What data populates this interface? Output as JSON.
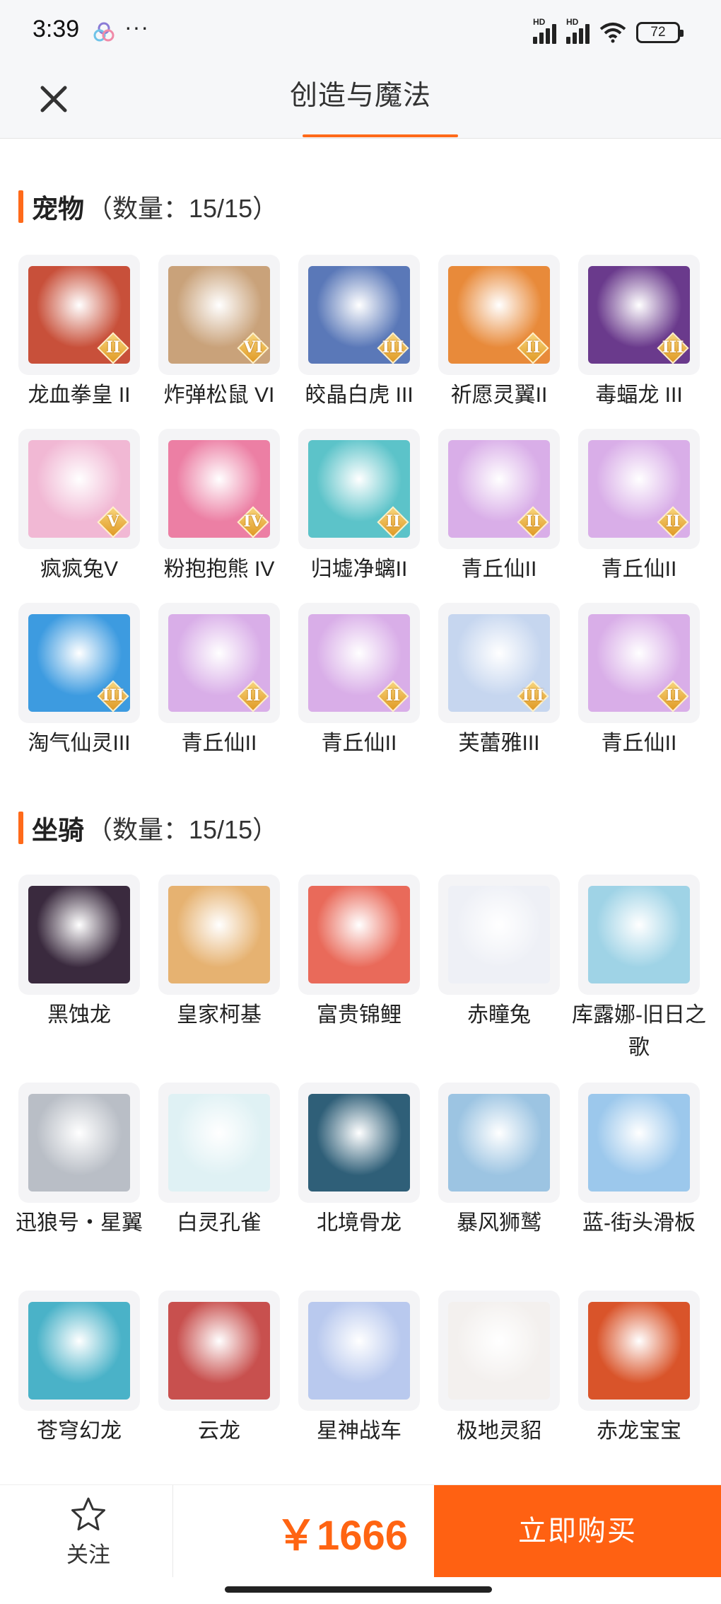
{
  "status_bar": {
    "time": "3:39",
    "more": "···",
    "battery": "72",
    "signal_label": "HD"
  },
  "header": {
    "title": "创造与魔法"
  },
  "pets": {
    "name": "宠物",
    "count": "（数量：15/15）",
    "items": [
      {
        "label": "龙血拳皇 II",
        "badge": "II",
        "icon": "red-dragon-fighter",
        "color": "#c8503a"
      },
      {
        "label": "炸弹松鼠 VI",
        "badge": "VI",
        "icon": "bomb-squirrel",
        "color": "#c9a27a"
      },
      {
        "label": "皎晶白虎 III",
        "badge": "III",
        "icon": "crystal-white-tiger",
        "color": "#5a78b8"
      },
      {
        "label": "祈愿灵翼II",
        "badge": "II",
        "icon": "wish-spirit-wing",
        "color": "#e88a3a"
      },
      {
        "label": "毒蝠龙 III",
        "badge": "III",
        "icon": "poison-bat-dragon",
        "color": "#6a3a8c"
      },
      {
        "label": "疯疯兔V",
        "badge": "V",
        "icon": "crazy-rabbit",
        "color": "#f1b8d4"
      },
      {
        "label": "粉抱抱熊 IV",
        "badge": "IV",
        "icon": "pink-hug-bear",
        "color": "#ec7fa4"
      },
      {
        "label": "归墟净螭II",
        "badge": "II",
        "icon": "sea-chi-dragon",
        "color": "#5cc3c9"
      },
      {
        "label": "青丘仙II",
        "badge": "II",
        "icon": "qingqiu-fairy",
        "color": "#d9aee8"
      },
      {
        "label": "青丘仙II",
        "badge": "II",
        "icon": "qingqiu-fairy",
        "color": "#d9aee8"
      },
      {
        "label": "淘气仙灵III",
        "badge": "III",
        "icon": "naughty-spirit",
        "color": "#3d9be0"
      },
      {
        "label": "青丘仙II",
        "badge": "II",
        "icon": "qingqiu-fairy",
        "color": "#d9aee8"
      },
      {
        "label": "青丘仙II",
        "badge": "II",
        "icon": "qingqiu-fairy",
        "color": "#d9aee8"
      },
      {
        "label": "芙蕾雅III",
        "badge": "III",
        "icon": "freya",
        "color": "#c6d6ef"
      },
      {
        "label": "青丘仙II",
        "badge": "II",
        "icon": "qingqiu-fairy",
        "color": "#d9aee8"
      }
    ]
  },
  "mounts": {
    "name": "坐骑",
    "count": "（数量：15/15）",
    "items": [
      {
        "label": "黑蚀龙",
        "icon": "black-eclipse-dragon",
        "color": "#3a2a3e"
      },
      {
        "label": "皇家柯基",
        "icon": "royal-corgi",
        "color": "#e6b271"
      },
      {
        "label": "富贵锦鲤",
        "icon": "lucky-koi",
        "color": "#e96a5a"
      },
      {
        "label": "赤瞳兔",
        "icon": "red-eye-rabbit",
        "color": "#eef0f6"
      },
      {
        "label": "库露娜-旧日之歌",
        "icon": "kuluna",
        "color": "#9fd3e6"
      },
      {
        "label": "迅狼号・星翼",
        "icon": "star-wing-wolf",
        "color": "#b9bec6"
      },
      {
        "label": "白灵孔雀",
        "icon": "white-peacock",
        "color": "#dff1f4"
      },
      {
        "label": "北境骨龙",
        "icon": "north-bone-dragon",
        "color": "#2f5f78"
      },
      {
        "label": "暴风狮鹫",
        "icon": "storm-griffin",
        "color": "#9cc4e2"
      },
      {
        "label": "蓝-街头滑板",
        "icon": "blue-skateboard",
        "color": "#9cc8ec"
      },
      {
        "label": "苍穹幻龙",
        "icon": "sky-phantom-dragon",
        "color": "#4ab2c8"
      },
      {
        "label": "云龙",
        "icon": "cloud-dragon",
        "color": "#c8504e"
      },
      {
        "label": "星神战车",
        "icon": "star-god-chariot",
        "color": "#b9c9ee"
      },
      {
        "label": "极地灵貂",
        "icon": "polar-marten",
        "color": "#f3f0ee"
      },
      {
        "label": "赤龙宝宝",
        "icon": "red-dragon-baby",
        "color": "#d9542a"
      }
    ]
  },
  "bottom_bar": {
    "follow_label": "关注",
    "price": "￥1666",
    "buy_label": "立即购买"
  },
  "colors": {
    "accent": "#ff6112",
    "price": "#ff6412"
  }
}
